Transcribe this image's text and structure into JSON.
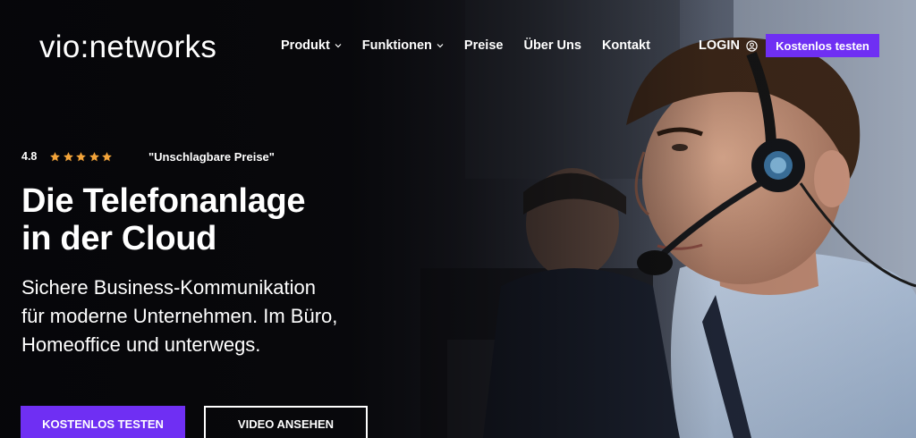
{
  "brand": {
    "logo_text": "vio:networks"
  },
  "nav": {
    "items": [
      {
        "label": "Produkt",
        "has_dropdown": true
      },
      {
        "label": "Funktionen",
        "has_dropdown": true
      },
      {
        "label": "Preise",
        "has_dropdown": false
      },
      {
        "label": "Über Uns",
        "has_dropdown": false
      },
      {
        "label": "Kontakt",
        "has_dropdown": false
      }
    ],
    "login_label": "LOGIN",
    "login_icon": "user-circle-icon",
    "cta_label": "Kostenlos testen"
  },
  "hero": {
    "rating_value": "4.8",
    "stars": 5,
    "quote": "\"Unschlagbare Preise\"",
    "headline_line1": "Die Telefonanlage",
    "headline_line2": "in der Cloud",
    "subline_line1": "Sichere Business-Kommunikation",
    "subline_line2": "für moderne Unternehmen. Im Büro,",
    "subline_line3": "Homeoffice und unterwegs.",
    "primary_button": "KOSTENLOS TESTEN",
    "secondary_button": "VIDEO ANSEHEN"
  },
  "colors": {
    "accent": "#6f2ff3",
    "star": "#f3a43a",
    "background": "#0c0c10",
    "text": "#ffffff"
  }
}
